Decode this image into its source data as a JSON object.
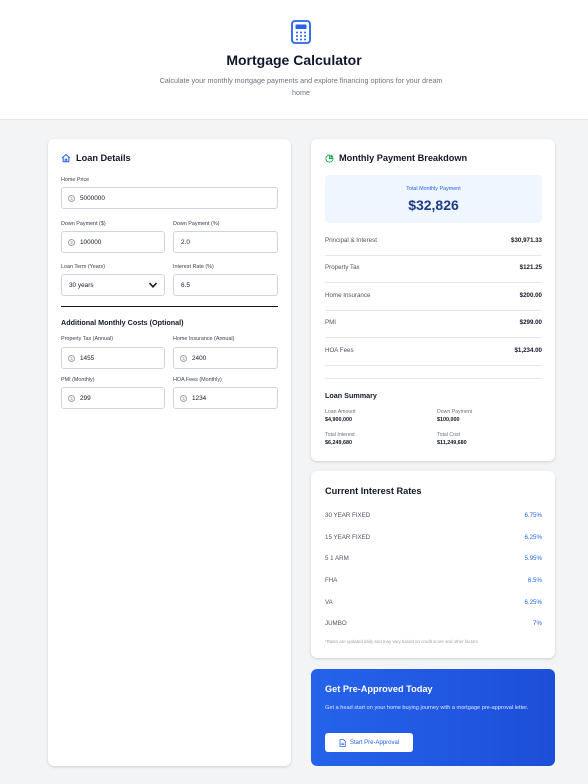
{
  "header": {
    "title": "Mortgage Calculator",
    "subtitle": "Calculate your monthly mortgage payments and explore financing options for your dream home",
    "icon": "calculator-icon"
  },
  "loan_details": {
    "title": "Loan Details",
    "home_price": {
      "label": "Home Price",
      "value": "5000000"
    },
    "down_payment_dollar": {
      "label": "Down Payment ($)",
      "value": "100000"
    },
    "down_payment_percent": {
      "label": "Down Payment (%)",
      "value": "2.0"
    },
    "loan_term": {
      "label": "Loan Term (Years)",
      "value": "30 years"
    },
    "interest_rate": {
      "label": "Interest Rate (%)",
      "value": "6.5"
    },
    "additional_title": "Additional Monthly Costs (Optional)",
    "property_tax": {
      "label": "Property Tax (Annual)",
      "value": "1455"
    },
    "home_insurance": {
      "label": "Home Insurance (Annual)",
      "value": "2400"
    },
    "pmi": {
      "label": "PMI (Monthly)",
      "value": "299"
    },
    "hoa": {
      "label": "HOA Fees (Monthly)",
      "value": "1234"
    }
  },
  "breakdown": {
    "title": "Monthly Payment Breakdown",
    "total_label": "Total Monthly Payment",
    "total_value": "$32,826",
    "rows": [
      {
        "label": "Principal & Interest",
        "value": "$30,971.33"
      },
      {
        "label": "Property Tax",
        "value": "$121.25"
      },
      {
        "label": "Home Insurance",
        "value": "$200.00"
      },
      {
        "label": "PMI",
        "value": "$299.00"
      },
      {
        "label": "HOA Fees",
        "value": "$1,234.00"
      }
    ],
    "summary_title": "Loan Summary",
    "summary": [
      {
        "label": "Loan Amount",
        "value": "$4,900,000"
      },
      {
        "label": "Down Payment",
        "value": "$100,000"
      },
      {
        "label": "Total Interest",
        "value": "$6,249,680"
      },
      {
        "label": "Total Cost",
        "value": "$11,249,680"
      }
    ]
  },
  "rates": {
    "title": "Current Interest Rates",
    "rows": [
      {
        "label": "30 YEAR FIXED",
        "value": "6.75%"
      },
      {
        "label": "15 YEAR FIXED",
        "value": "6.25%"
      },
      {
        "label": "5 1 ARM",
        "value": "5.95%"
      },
      {
        "label": "FHA",
        "value": "6.5%"
      },
      {
        "label": "VA",
        "value": "6.25%"
      },
      {
        "label": "JUMBO",
        "value": "7%"
      }
    ],
    "note": "*Rates are updated daily and may vary based on credit score and other factors"
  },
  "cta": {
    "title": "Get Pre-Approved Today",
    "text": "Get a head start on your home buying journey with a mortgage pre-approval letter.",
    "button": "Start Pre-Approval"
  },
  "colors": {
    "accent": "#2563eb",
    "total_text": "#1e3a8a",
    "total_bg": "#eff6ff",
    "page_bg": "#f3f4f6"
  }
}
